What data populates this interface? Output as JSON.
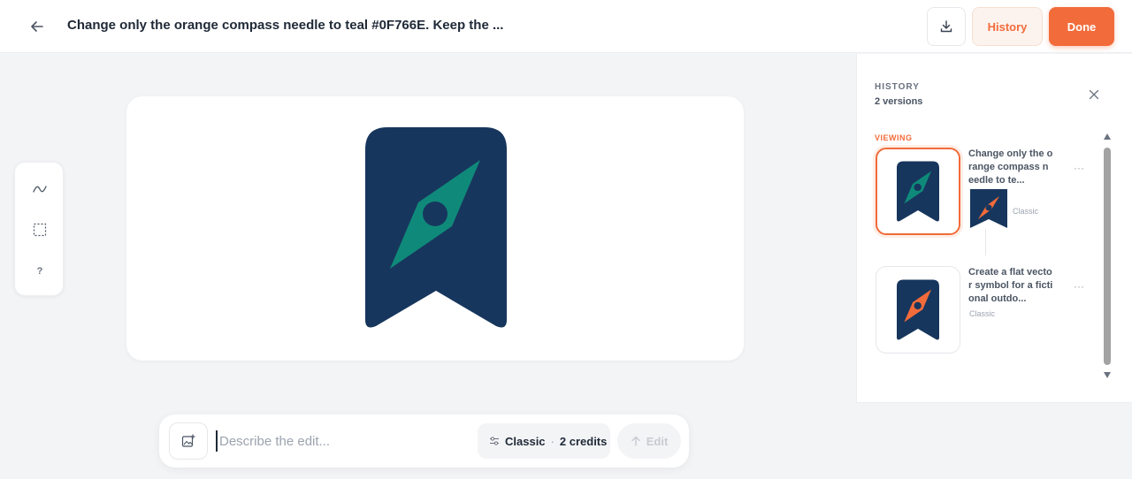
{
  "header": {
    "title": "Change only the orange compass needle to teal #0F766E. Keep the ...",
    "history_label": "History",
    "done_label": "Done"
  },
  "tools": {
    "help_label": "?"
  },
  "prompt": {
    "placeholder": "Describe the edit...",
    "mode": "Classic",
    "credits": "2 credits",
    "edit_label": "Edit"
  },
  "history": {
    "heading": "HISTORY",
    "count": "2 versions",
    "viewing_label": "VIEWING",
    "versions": [
      {
        "text": "Change only the orange compass needle to te...",
        "tag": "Classic",
        "needle_color": "#0F766E"
      },
      {
        "text": "Create a flat vector symbol for a fictional outdo...",
        "tag": "Classic",
        "needle_color": "#F26B3A"
      }
    ]
  },
  "colors": {
    "accent": "#F26B3A",
    "navy": "#17365D",
    "teal": "#0F8A7A",
    "orange_needle": "#F26B3A"
  }
}
